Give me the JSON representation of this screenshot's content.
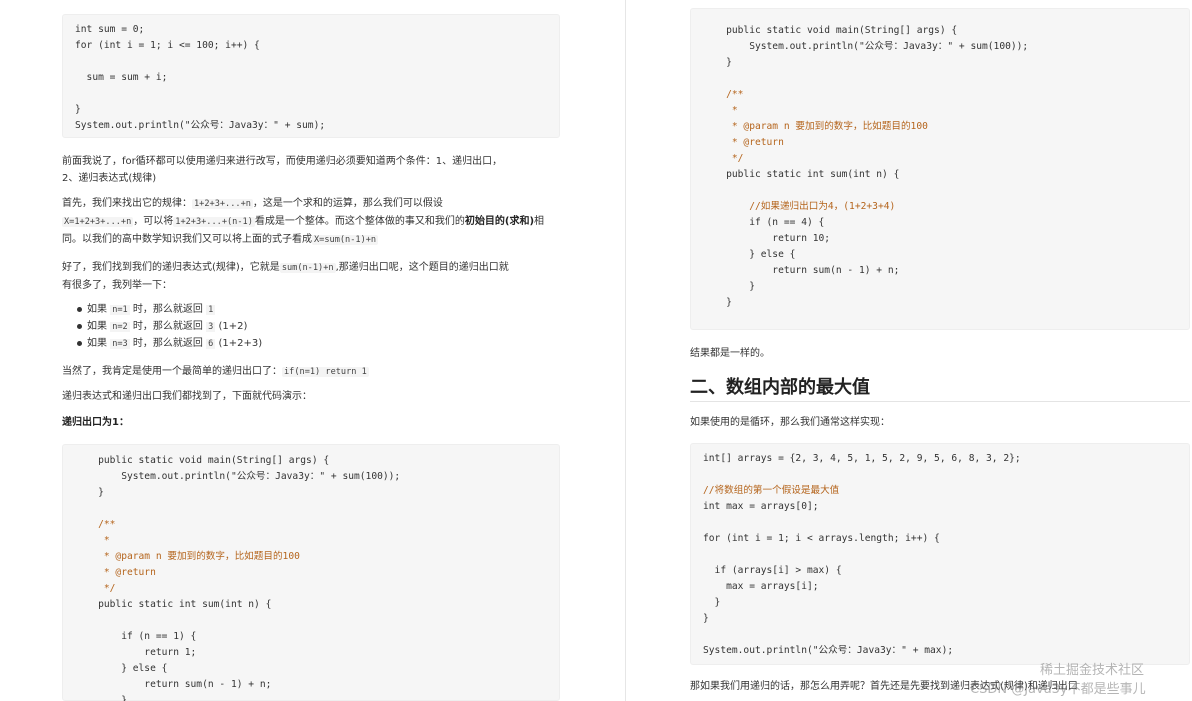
{
  "left": {
    "code1": [
      "int sum = 0;",
      "for (int i = 1; i <= 100; i++) {",
      "",
      "  sum = sum + i;",
      "",
      "}",
      "System.out.println(\"公众号：Java3y：\" + sum);"
    ],
    "p1_line1": "前面我说了，for循环都可以使用递归来进行改写，而使用递归必须要知道两个条件：1、递归出口，",
    "p1_line2": "2、递归表达式(规律)",
    "p2_a": "首先，我们来找出它的规律：",
    "p2_code1": "1+2+3+...+n",
    "p2_b": "，这是一个求和的运算，那么我们可以假设",
    "p2_code2": "X=1+2+3+...+n",
    "p2_c": "，可以将",
    "p2_code3": "1+2+3+...+(n-1)",
    "p2_d": "看成是一个整体。而这个整体做的事又和我们的",
    "p2_bold": "初始目的(求和)",
    "p2_e": "相同。以我们的高中数学知识我们又可以将上面的式子看成",
    "p2_code4": "X=sum(n-1)+n",
    "p3_a": "好了，我们找到我们的递归表达式(规律)，它就是",
    "p3_code": "sum(n-1)+n",
    "p3_b": ",那递归出口呢，这个题目的递归出口就",
    "p3_line2": "有很多了，我列举一下：",
    "bullets": [
      {
        "pre": "如果 ",
        "code": "n=1",
        "mid": " 时，那么就返回 ",
        "ret": "1",
        "post": ""
      },
      {
        "pre": "如果 ",
        "code": "n=2",
        "mid": " 时，那么就返回 ",
        "ret": "3",
        "post": " (1+2)"
      },
      {
        "pre": "如果 ",
        "code": "n=3",
        "mid": " 时，那么就返回 ",
        "ret": "6",
        "post": " (1+2+3)"
      }
    ],
    "p4_a": "当然了，我肯定是使用一个最简单的递归出口了：",
    "p4_code": "if(n=1) return 1",
    "p5": "递归表达式和递归出口我们都找到了，下面就代码演示：",
    "p6_bold": "递归出口为1：",
    "code2": [
      "    public static void main(String[] args) {",
      "        System.out.println(\"公众号：Java3y：\" + sum(100));",
      "    }",
      "",
      "    /**",
      "     *",
      "     * @param n 要加到的数字，比如题目的100",
      "     * @return",
      "     */",
      "    public static int sum(int n) {",
      "",
      "        if (n == 1) {",
      "            return 1;",
      "        } else {",
      "            return sum(n - 1) + n;",
      "        }"
    ]
  },
  "right": {
    "code3": [
      "    public static void main(String[] args) {",
      "        System.out.println(\"公众号：Java3y：\" + sum(100));",
      "    }",
      "",
      "    /**",
      "     *",
      "     * @param n 要加到的数字，比如题目的100",
      "     * @return",
      "     */",
      "    public static int sum(int n) {",
      "",
      "        //如果递归出口为4，(1+2+3+4)",
      "        if (n == 4) {",
      "            return 10;",
      "        } else {",
      "            return sum(n - 1) + n;",
      "        }",
      "    }"
    ],
    "p1": "结果都是一样的。",
    "heading": "二、数组内部的最大值",
    "p2": "如果使用的是循环，那么我们通常这样实现：",
    "code4": [
      "int[] arrays = {2, 3, 4, 5, 1, 5, 2, 9, 5, 6, 8, 3, 2};",
      "",
      "//将数组的第一个假设是最大值",
      "int max = arrays[0];",
      "",
      "for (int i = 1; i < arrays.length; i++) {",
      "",
      "  if (arrays[i] > max) {",
      "    max = arrays[i];",
      "  }",
      "}",
      "",
      "System.out.println(\"公众号：Java3y：\" + max);"
    ],
    "p3": "那如果我们用递归的话，那怎么用弄呢？首先还是先要找到递归表达式(规律)和递归出口"
  },
  "watermark": "稀土掘金技术社区",
  "watermark2": "CSDN @Java3y不都是些事儿"
}
